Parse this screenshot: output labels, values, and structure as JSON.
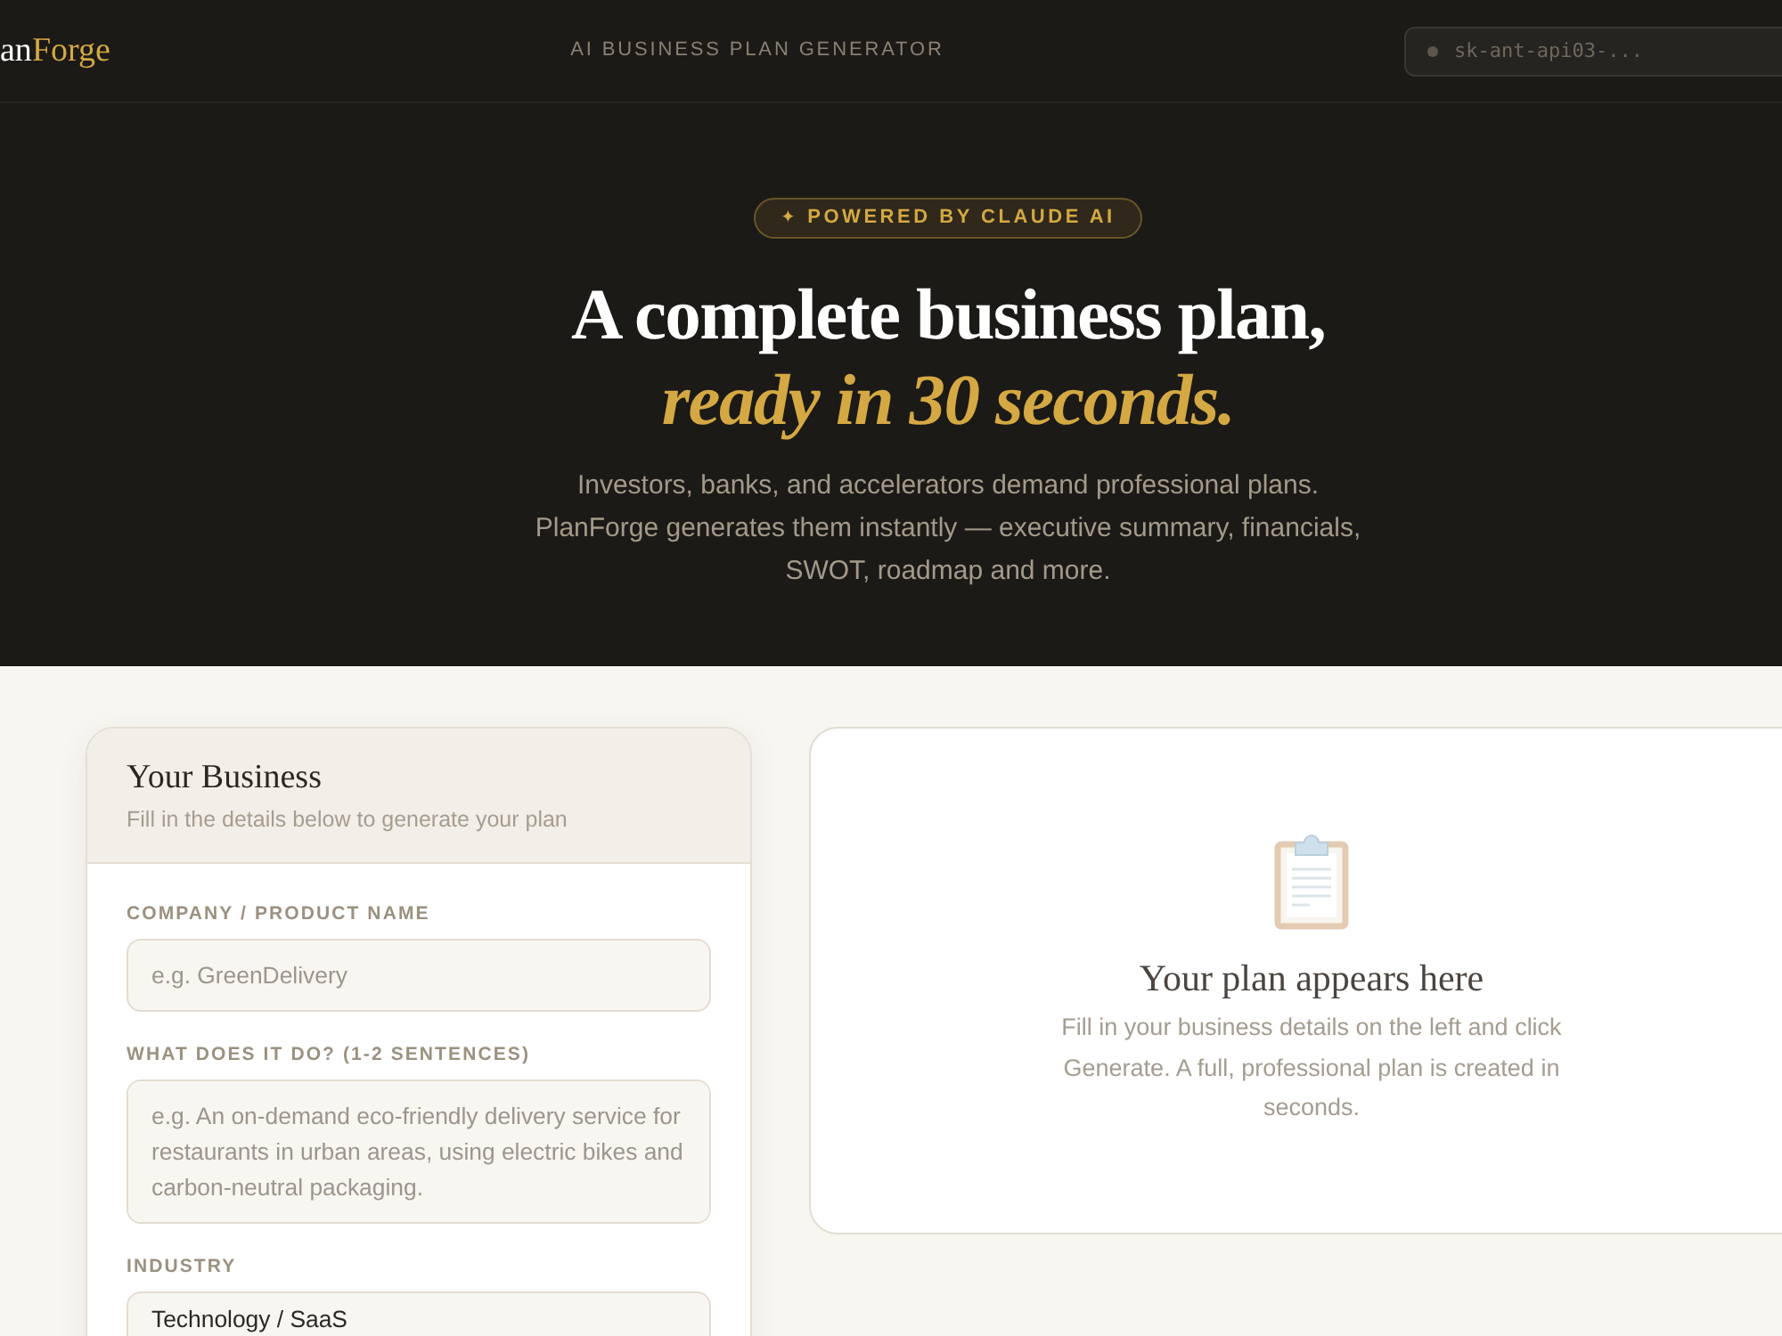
{
  "header": {
    "logo": [
      {
        "text": "an",
        "kind": "plain"
      },
      {
        "text": "Forge",
        "kind": "accent"
      }
    ],
    "tagline": "AI BUSINESS PLAN GENERATOR",
    "api_key": {
      "placeholder": "sk-ant-api03-..."
    }
  },
  "hero": {
    "badge": {
      "icon": "✦",
      "label": "POWERED BY CLAUDE AI"
    },
    "title": "A complete business plan,",
    "title_highlight": "ready in 30 seconds.",
    "subtitle": "Investors, banks, and accelerators demand professional plans. PlanForge generates them instantly — executive summary, financials, SWOT, roadmap and more."
  },
  "form_card": {
    "title": "Your Business",
    "subtitle": "Fill in the details below to generate your plan",
    "fields": [
      {
        "label": "COMPANY / PRODUCT NAME",
        "kind": "input",
        "placeholder": "e.g. GreenDelivery"
      },
      {
        "label": "WHAT DOES IT DO? (1-2 SENTENCES)",
        "kind": "textarea",
        "placeholder": "e.g. An on-demand eco-friendly delivery service for restaurants in urban areas, using electric bikes and carbon-neutral packaging."
      },
      {
        "label": "INDUSTRY",
        "kind": "select",
        "value": "Technology / SaaS"
      }
    ]
  },
  "preview": {
    "title": "Your plan appears here",
    "text": "Fill in your business details on the left and click Generate. A full, professional plan is created in seconds."
  }
}
